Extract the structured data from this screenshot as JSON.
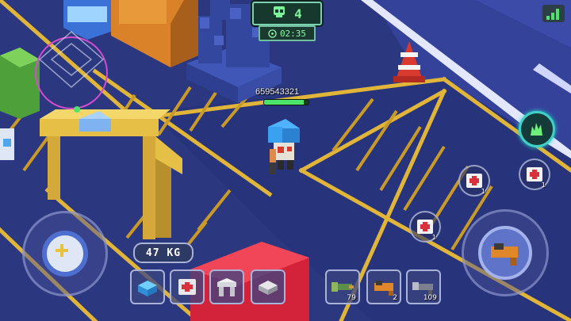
{
  "hud": {
    "players_alive": "4",
    "timer": "02:35"
  },
  "player": {
    "name": "659543321",
    "health_fraction": 0.9
  },
  "inventory": {
    "weight": "47 KG",
    "items": [
      {
        "name": "blue-block-item",
        "count": ""
      },
      {
        "name": "medkit-block-item",
        "count": ""
      },
      {
        "name": "white-arch-item",
        "count": ""
      },
      {
        "name": "gray-block-item",
        "count": ""
      }
    ],
    "weapons": [
      {
        "name": "green-gun-weapon",
        "count": "79"
      },
      {
        "name": "orange-gun-weapon",
        "count": "2"
      },
      {
        "name": "gray-gun-weapon",
        "count": "109"
      }
    ]
  },
  "medkits": [
    {
      "count": "1"
    },
    {
      "count": "1"
    },
    {
      "count": "1"
    }
  ],
  "colors": {
    "ground": "#2c3a86",
    "rail": "#e1b53a",
    "road": "#e3e8ff",
    "health": "#4ee46c",
    "ability": "#3fd0c8"
  },
  "icons": {
    "joystick": "plus-icon",
    "fire": "gun-icon",
    "ability": "green-flame-icon",
    "signal": "signal-bars-icon",
    "players": "skull-icon",
    "timer": "radiation-icon"
  }
}
